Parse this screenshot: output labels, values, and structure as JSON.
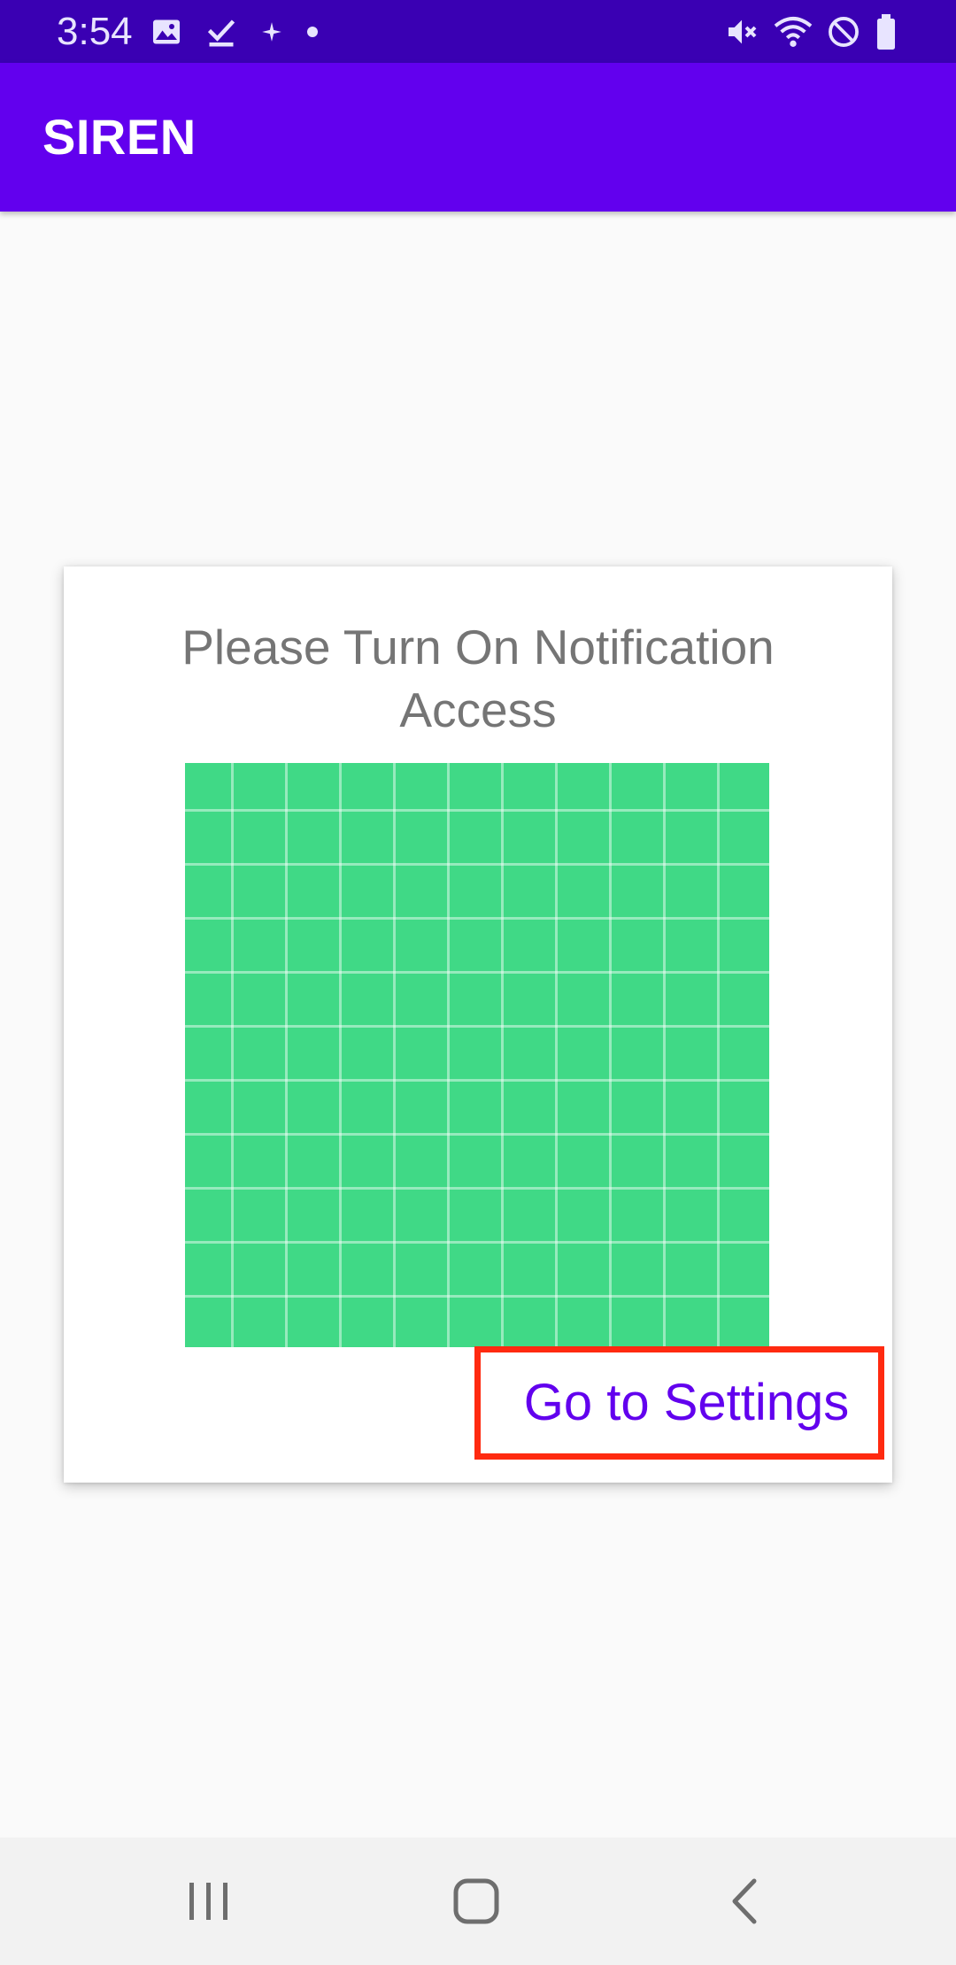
{
  "status_bar": {
    "time": "3:54",
    "left_icons": [
      "image-icon",
      "check-download-icon",
      "sparkle-icon",
      "dot-icon"
    ],
    "right_icons": [
      "mute-icon",
      "wifi-icon",
      "do-not-disturb-icon",
      "battery-icon"
    ]
  },
  "app_bar": {
    "title": "SIREN"
  },
  "card": {
    "message": "Please Turn On Notification Access",
    "image": "green-grid-image",
    "button_label": "Go to Settings"
  },
  "nav_bar": {
    "icons": [
      "recents-icon",
      "home-icon",
      "back-icon"
    ]
  },
  "colors": {
    "status_bar": "#3a00b3",
    "app_bar": "#6200ee",
    "accent": "#6200ee",
    "image_green": "#40d986",
    "highlight_border": "#ff2a10",
    "message_text": "#757575",
    "background": "#fafafa"
  }
}
